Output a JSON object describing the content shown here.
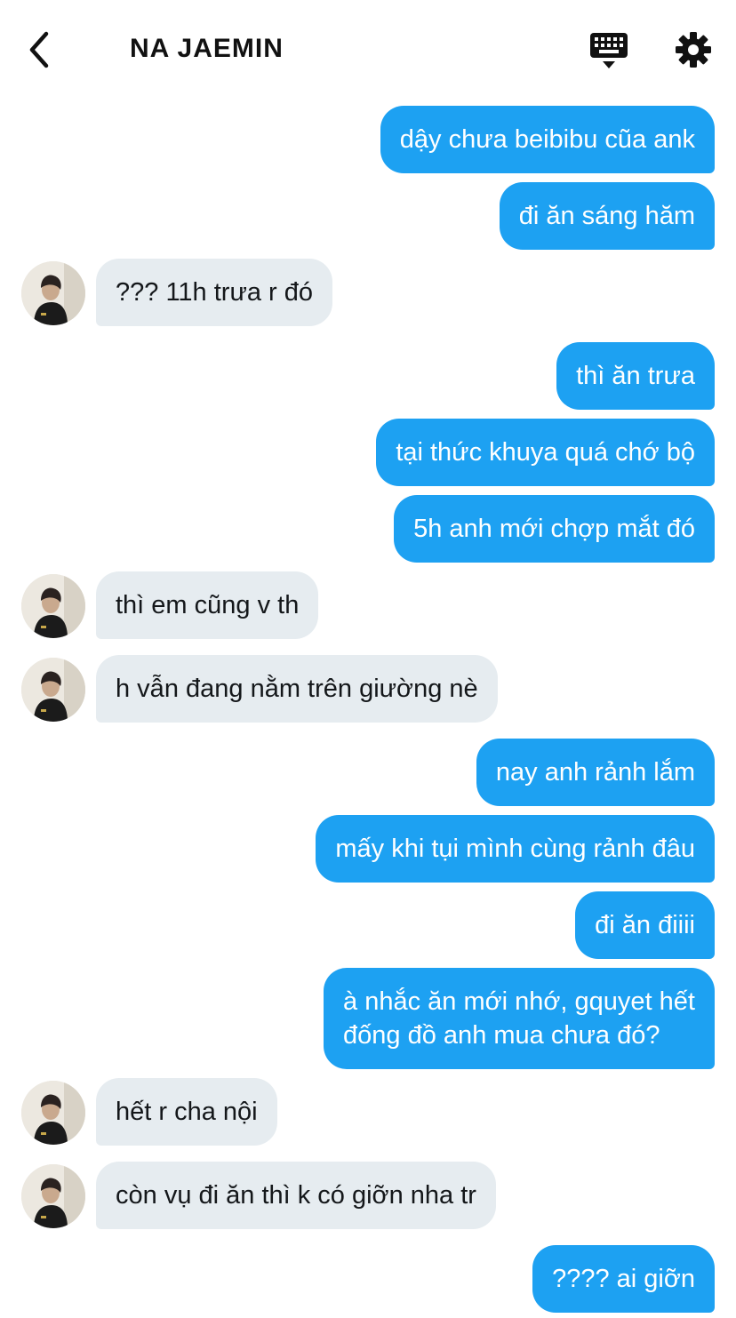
{
  "header": {
    "back_icon": "chevron-left-icon",
    "title": "NA JAEMIN",
    "keyboard_icon": "keyboard-icon",
    "settings_icon": "gear-icon"
  },
  "colors": {
    "outgoing_bubble": "#1da1f2",
    "incoming_bubble": "#e6ecf0"
  },
  "messages": [
    {
      "dir": "out",
      "text": "dậy chưa beibibu cũa ank"
    },
    {
      "dir": "out",
      "text": "đi ăn sáng hăm"
    },
    {
      "dir": "in",
      "text": "??? 11h trưa r đó"
    },
    {
      "dir": "out",
      "text": "thì ăn trưa"
    },
    {
      "dir": "out",
      "text": "tại thức khuya quá chớ bộ"
    },
    {
      "dir": "out",
      "text": "5h anh mới chợp mắt đó"
    },
    {
      "dir": "in",
      "text": "thì em cũng v th"
    },
    {
      "dir": "in",
      "text": "h vẫn đang nằm trên giường nè"
    },
    {
      "dir": "out",
      "text": "nay anh rảnh lắm"
    },
    {
      "dir": "out",
      "text": "mấy khi tụi mình cùng rảnh đâu"
    },
    {
      "dir": "out",
      "text": "đi ăn điiii"
    },
    {
      "dir": "out",
      "text": "à nhắc ăn mới nhớ, gquyet hết\nđống đồ anh mua chưa đó?"
    },
    {
      "dir": "in",
      "text": "hết r cha nội"
    },
    {
      "dir": "in",
      "text": "còn vụ đi ăn thì k có giỡn nha tr"
    },
    {
      "dir": "out",
      "text": "???? ai giỡn"
    }
  ]
}
